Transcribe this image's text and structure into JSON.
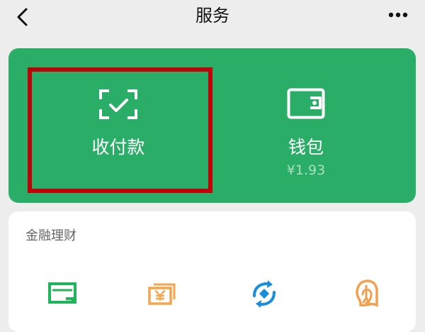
{
  "nav": {
    "title": "服务"
  },
  "pay_section": {
    "pay": {
      "label": "收付款"
    },
    "wallet": {
      "label": "钱包",
      "balance": "¥1.93"
    }
  },
  "finance_section": {
    "title": "金融理财"
  },
  "colors": {
    "green_panel": "#2aae67",
    "highlight_border": "#c20007",
    "credit_card_icon": "#20b45d",
    "money_icon": "#f3a64a",
    "sync_icon": "#188edc",
    "lock_icon": "#f0a04e"
  },
  "icons": {
    "back": "chevron-left-icon",
    "more": "more-options-icon",
    "pay": "scan-check-icon",
    "wallet": "wallet-icon",
    "finance_items": [
      "credit-card-icon",
      "yuan-banknote-icon",
      "refresh-coin-icon",
      "lock-fingerprint-icon"
    ]
  }
}
